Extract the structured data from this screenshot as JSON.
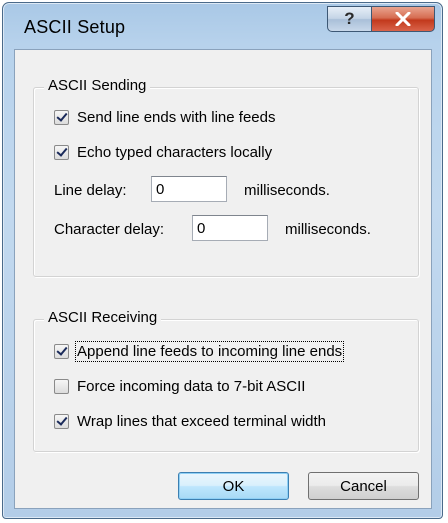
{
  "window": {
    "title": "ASCII Setup",
    "help_glyph": "?",
    "close_glyph": "✕"
  },
  "ascii_sending": {
    "legend": "ASCII Sending",
    "send_line_ends": {
      "label": "Send line ends with line feeds",
      "checked": true
    },
    "echo_typed": {
      "label": "Echo typed characters locally",
      "checked": true
    },
    "line_delay": {
      "label": "Line delay:",
      "value": "0",
      "units": "milliseconds."
    },
    "character_delay": {
      "label": "Character delay:",
      "value": "0",
      "units": "milliseconds."
    }
  },
  "ascii_receiving": {
    "legend": "ASCII Receiving",
    "append_line_feeds": {
      "label": "Append line feeds to incoming line ends",
      "checked": true
    },
    "force_7bit": {
      "label": "Force incoming data to 7-bit ASCII",
      "checked": false
    },
    "wrap_lines": {
      "label": "Wrap lines that exceed terminal width",
      "checked": true
    }
  },
  "buttons": {
    "ok": "OK",
    "cancel": "Cancel"
  },
  "colors": {
    "title_bar": "#b7d2ec",
    "close_button": "#c2391c",
    "dialog_face": "#f0f0f0",
    "default_button_border": "#3c7fb1"
  }
}
